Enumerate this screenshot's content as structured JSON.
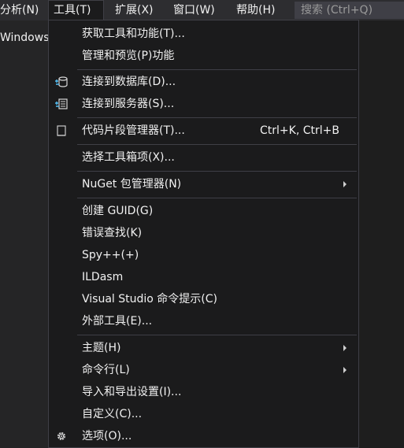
{
  "menubar": {
    "items": [
      {
        "label": "分析(N)"
      },
      {
        "label": "工具(T)"
      },
      {
        "label": "扩展(X)"
      },
      {
        "label": "窗口(W)"
      },
      {
        "label": "帮助(H)"
      }
    ],
    "search_placeholder": "搜索 (Ctrl+Q)"
  },
  "background": {
    "windows_label": "Windows"
  },
  "tools_menu": {
    "items": [
      {
        "label": "获取工具和功能(T)..."
      },
      {
        "label": "管理和预览(P)功能"
      },
      {
        "label": "连接到数据库(D)...",
        "icon": "database-connect-icon"
      },
      {
        "label": "连接到服务器(S)...",
        "icon": "server-connect-icon"
      },
      {
        "label": "代码片段管理器(T)...",
        "icon": "code-snippet-icon",
        "shortcut": "Ctrl+K, Ctrl+B"
      },
      {
        "label": "选择工具箱项(X)..."
      },
      {
        "label": "NuGet 包管理器(N)",
        "submenu": true
      },
      {
        "label": "创建 GUID(G)"
      },
      {
        "label": "错误查找(K)"
      },
      {
        "label": "Spy++(+)"
      },
      {
        "label": "ILDasm"
      },
      {
        "label": "Visual Studio 命令提示(C)"
      },
      {
        "label": "外部工具(E)..."
      },
      {
        "label": "主题(H)",
        "submenu": true
      },
      {
        "label": "命令行(L)",
        "submenu": true
      },
      {
        "label": "导入和导出设置(I)..."
      },
      {
        "label": "自定义(C)..."
      },
      {
        "label": "选项(O)...",
        "icon": "gear-icon"
      }
    ]
  },
  "colors": {
    "menu_bg": "#1b1b1c",
    "menubar_bg": "#2d2d30",
    "border": "#3f3f46",
    "text": "#f1f1f1",
    "icon_accent": "#4fb6e8"
  }
}
